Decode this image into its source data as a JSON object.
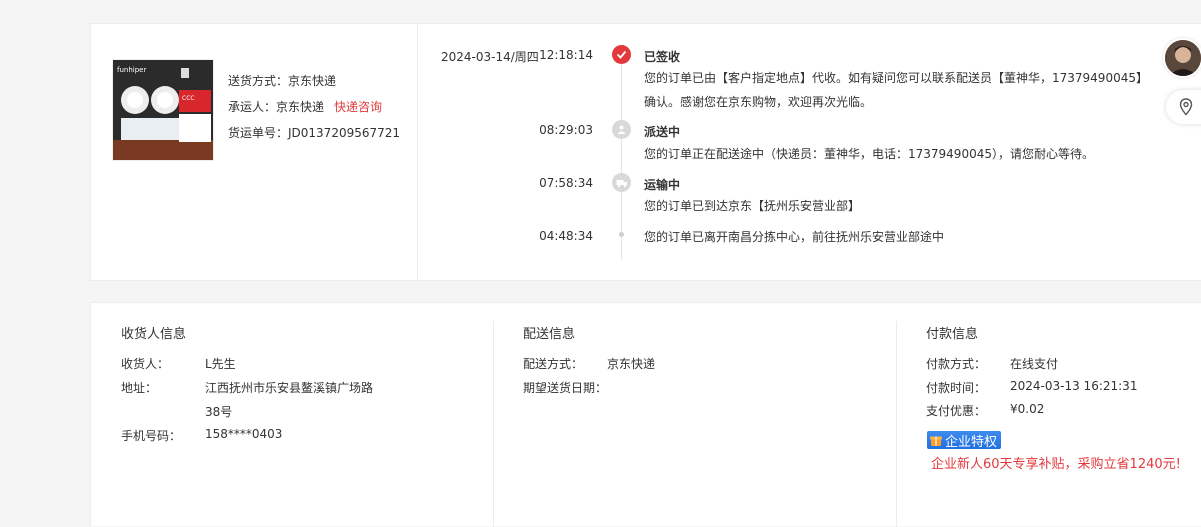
{
  "product": {
    "image_icon": "product-thumbnail-emergency-light",
    "ship_method": "送货方式：京东快递",
    "carrier": "承运人：京东快递",
    "carrier_link": "快递咨询",
    "tracking_no": "货运单号：JD0137209567721"
  },
  "tracking": {
    "date": "2024-03-14/周四",
    "events": [
      {
        "time": "12:18:14",
        "status": "已签收",
        "desc": "您的订单已由【客户指定地点】代收。如有疑问您可以联系配送员【董神华，17379490045】确认。感谢您在京东购物，欢迎再次光临。",
        "icon": "check-icon"
      },
      {
        "time": "08:29:03",
        "status": "派送中",
        "desc": "您的订单正在配送途中（快递员：董神华，电话：17379490045），请您耐心等待。",
        "icon": "courier-icon"
      },
      {
        "time": "07:58:34",
        "status": "运输中",
        "desc": "您的订单已到达京东【抚州乐安营业部】",
        "icon": "truck-icon"
      },
      {
        "time": "04:48:34",
        "status": "",
        "desc": "您的订单已离开南昌分拣中心，前往抚州乐安营业部途中",
        "icon": "dot-icon"
      }
    ]
  },
  "consignee": {
    "title": "收货人信息",
    "name_label": "收货人：",
    "name": "L先生",
    "addr_label": "地址：",
    "addr_line1": "江西抚州市乐安县鳌溪镇广场路",
    "addr_line2": "38号",
    "phone_label": "手机号码：",
    "phone": "158****0403"
  },
  "delivery": {
    "title": "配送信息",
    "method_label": "配送方式：",
    "method": "京东快递",
    "date_label": "期望送货日期："
  },
  "payment": {
    "title": "付款信息",
    "method_label": "付款方式：",
    "method": "在线支付",
    "time_label": "付款时间：",
    "time": "2024-03-13 16:21:31",
    "discount_label": "支付优惠：",
    "discount": "¥0.02",
    "badge": "企业特权",
    "promo": "企业新人60天专享补贴，采购立省1240元!"
  },
  "colors": {
    "accent": "#e4393c",
    "badge": "#2f7fe8"
  }
}
